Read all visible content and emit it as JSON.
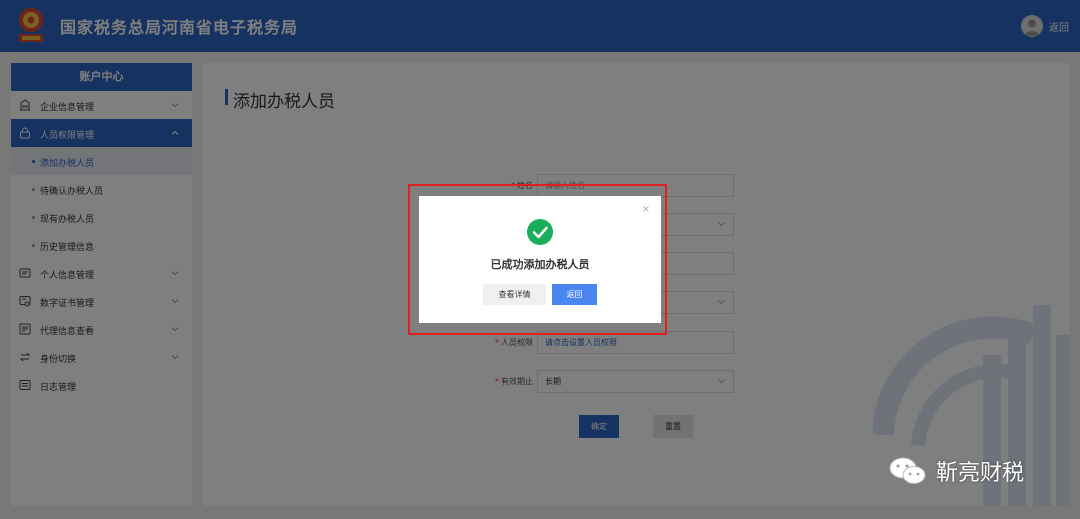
{
  "header": {
    "title": "国家税务总局河南省电子税务局",
    "back_label": "返回"
  },
  "sidebar": {
    "heading": "账户中心",
    "items": [
      {
        "label": "企业信息管理",
        "icon": "building-icon"
      },
      {
        "label": "人员权限管理",
        "icon": "user-lock-icon",
        "active": true
      },
      {
        "label": "个人信息管理",
        "icon": "id-card-icon"
      },
      {
        "label": "数字证书管理",
        "icon": "certificate-icon"
      },
      {
        "label": "代理信息查看",
        "icon": "proxy-icon"
      },
      {
        "label": "身份切换",
        "icon": "switch-icon"
      },
      {
        "label": "日志管理",
        "icon": "log-icon"
      }
    ],
    "subitems": [
      {
        "label": "添加办税人员",
        "active": true
      },
      {
        "label": "待确认办税人员"
      },
      {
        "label": "现有办税人员"
      },
      {
        "label": "历史管理信息"
      }
    ]
  },
  "main": {
    "title": "添加办税人员",
    "form": {
      "name_label": "姓名",
      "name_placeholder": "请输入姓名",
      "permission_label": "人员权限",
      "permission_value": "请点击设置人员权限",
      "validity_label": "有效期止",
      "validity_value": "长期"
    },
    "confirm_label": "确定",
    "reset_label": "重置"
  },
  "modal": {
    "message": "已成功添加办税人员",
    "detail_label": "查看详情",
    "back_label": "返回",
    "close_glyph": "×"
  },
  "brand": {
    "name": "靳亮财税"
  },
  "colors": {
    "primary": "#2d64c3",
    "success": "#1aad5c",
    "highlight": "#e02020",
    "modal_button": "#4a86f0"
  }
}
